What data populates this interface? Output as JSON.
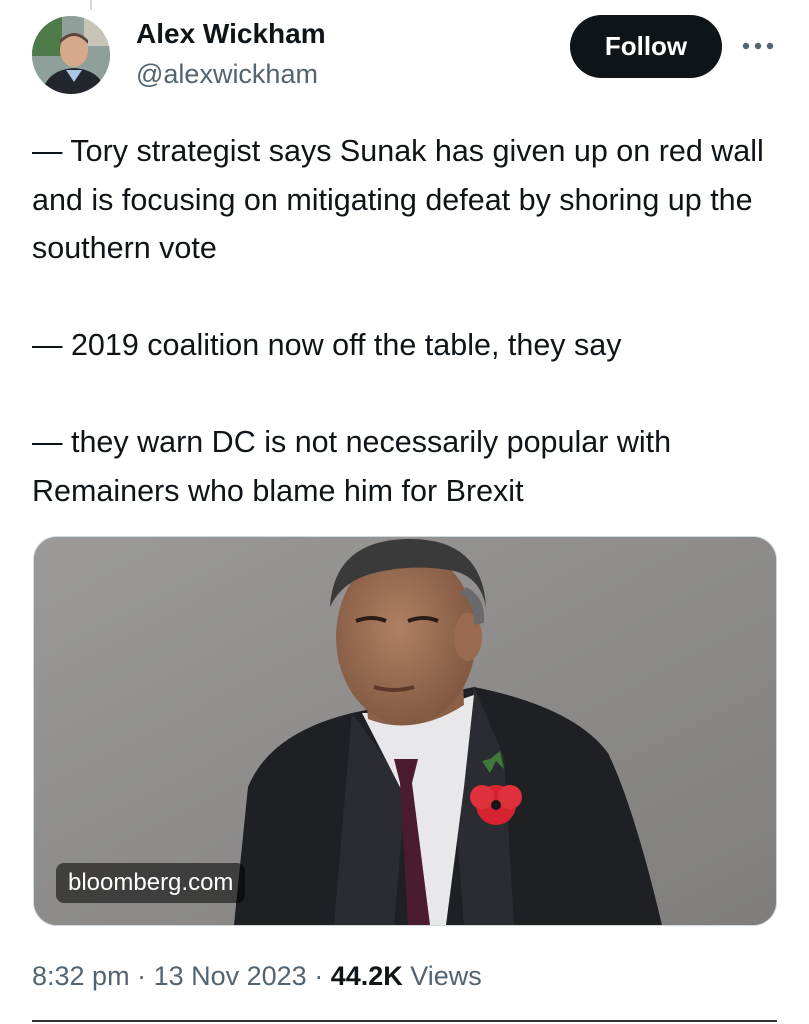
{
  "author": {
    "display_name": "Alex Wickham",
    "handle": "@alexwickham"
  },
  "header": {
    "follow_label": "Follow",
    "more_label": "•••"
  },
  "tweet": {
    "paragraphs": [
      "— Tory strategist says Sunak has given up on red wall and is focusing on mitigating defeat by shoring up the southern vote",
      "— 2019 coalition now off the table, they say",
      "— they warn DC is not necessarily popular with Remainers who blame him for Brexit"
    ]
  },
  "link_card": {
    "domain": "bloomberg.com"
  },
  "meta": {
    "time": "8:32 pm",
    "separator": " · ",
    "date": "13 Nov 2023",
    "views_count": "44.2K",
    "views_label": "Views"
  },
  "colors": {
    "text_primary": "#0f1419",
    "text_secondary": "#536471",
    "follow_bg": "#0f1419",
    "follow_text": "#ffffff"
  },
  "icons": {
    "more": "more-horizontal-icon"
  }
}
